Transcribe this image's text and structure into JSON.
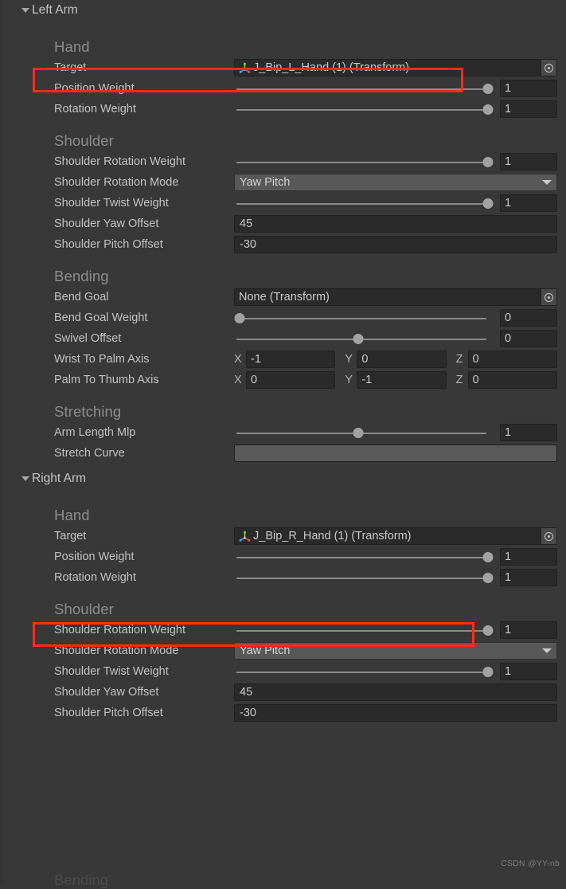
{
  "window": {
    "background": "#383838",
    "accent_highlight": "#ff2d13",
    "watermark": "CSDN @YY-nb",
    "cutoff_text": "Bending"
  },
  "sections": [
    {
      "name": "left-arm",
      "title": "Left Arm",
      "expanded": true,
      "groups": [
        {
          "name": "hand",
          "title": "Hand",
          "rows": [
            {
              "type": "object",
              "label": "Target",
              "value": "J_Bip_L_Hand (1) (Transform)",
              "icon": "transform-gizmo-icon",
              "highlighted": true
            },
            {
              "type": "slider",
              "label": "Position Weight",
              "value": "1",
              "fill": 98
            },
            {
              "type": "slider",
              "label": "Rotation Weight",
              "value": "1",
              "fill": 98
            }
          ]
        },
        {
          "name": "shoulder",
          "title": "Shoulder",
          "rows": [
            {
              "type": "slider",
              "label": "Shoulder Rotation Weight",
              "value": "1",
              "fill": 98
            },
            {
              "type": "dropdown",
              "label": "Shoulder Rotation Mode",
              "value": "Yaw Pitch"
            },
            {
              "type": "slider",
              "label": "Shoulder Twist Weight",
              "value": "1",
              "fill": 98
            },
            {
              "type": "text",
              "label": "Shoulder Yaw Offset",
              "value": "45"
            },
            {
              "type": "text",
              "label": "Shoulder Pitch Offset",
              "value": "-30"
            }
          ]
        },
        {
          "name": "bending",
          "title": "Bending",
          "rows": [
            {
              "type": "object",
              "label": "Bend Goal",
              "value": "None (Transform)",
              "icon": "none-icon",
              "highlighted": false
            },
            {
              "type": "slider",
              "label": "Bend Goal Weight",
              "value": "0",
              "fill": 2
            },
            {
              "type": "slider",
              "label": "Swivel Offset",
              "value": "0",
              "fill": 48
            },
            {
              "type": "vector3",
              "label": "Wrist To Palm Axis",
              "axes": [
                "X",
                "Y",
                "Z"
              ],
              "values": [
                "-1",
                "0",
                "0"
              ]
            },
            {
              "type": "vector3",
              "label": "Palm To Thumb Axis",
              "axes": [
                "X",
                "Y",
                "Z"
              ],
              "values": [
                "0",
                "-1",
                "0"
              ]
            }
          ]
        },
        {
          "name": "stretching",
          "title": "Stretching",
          "rows": [
            {
              "type": "slider",
              "label": "Arm Length Mlp",
              "value": "1",
              "fill": 48
            },
            {
              "type": "curve",
              "label": "Stretch Curve",
              "value": ""
            }
          ]
        }
      ]
    },
    {
      "name": "right-arm",
      "title": "Right Arm",
      "expanded": true,
      "groups": [
        {
          "name": "hand",
          "title": "Hand",
          "rows": [
            {
              "type": "object",
              "label": "Target",
              "value": "J_Bip_R_Hand (1) (Transform)",
              "icon": "transform-gizmo-icon",
              "highlighted": true
            },
            {
              "type": "slider",
              "label": "Position Weight",
              "value": "1",
              "fill": 98
            },
            {
              "type": "slider",
              "label": "Rotation Weight",
              "value": "1",
              "fill": 98
            }
          ]
        },
        {
          "name": "shoulder",
          "title": "Shoulder",
          "rows": [
            {
              "type": "slider",
              "label": "Shoulder Rotation Weight",
              "value": "1",
              "fill": 98
            },
            {
              "type": "dropdown",
              "label": "Shoulder Rotation Mode",
              "value": "Yaw Pitch"
            },
            {
              "type": "slider",
              "label": "Shoulder Twist Weight",
              "value": "1",
              "fill": 98
            },
            {
              "type": "text",
              "label": "Shoulder Yaw Offset",
              "value": "45"
            },
            {
              "type": "text",
              "label": "Shoulder Pitch Offset",
              "value": "-30"
            }
          ]
        }
      ]
    }
  ]
}
